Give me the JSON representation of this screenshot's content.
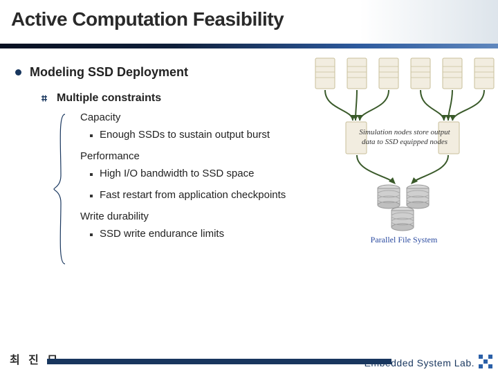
{
  "title": "Active Computation Feasibility",
  "content": {
    "l1": "Modeling SSD Deployment",
    "l2": "Multiple constraints",
    "groups": {
      "capacity": {
        "label": "Capacity",
        "item1": "Enough SSDs to sustain output burst"
      },
      "performance": {
        "label": "Performance",
        "item1": "High I/O bandwidth to SSD space",
        "item2": "Fast restart from application checkpoints"
      },
      "durability": {
        "label": "Write durability",
        "item1": "SSD write endurance limits"
      }
    }
  },
  "diagram": {
    "caption1": "Simulation nodes store output",
    "caption2": "data to SSD equipped nodes",
    "pfs_label": "Parallel File System"
  },
  "footer": {
    "name": "최 진 모",
    "lab": "Embedded System Lab."
  },
  "colors": {
    "accent": "#18365e"
  }
}
